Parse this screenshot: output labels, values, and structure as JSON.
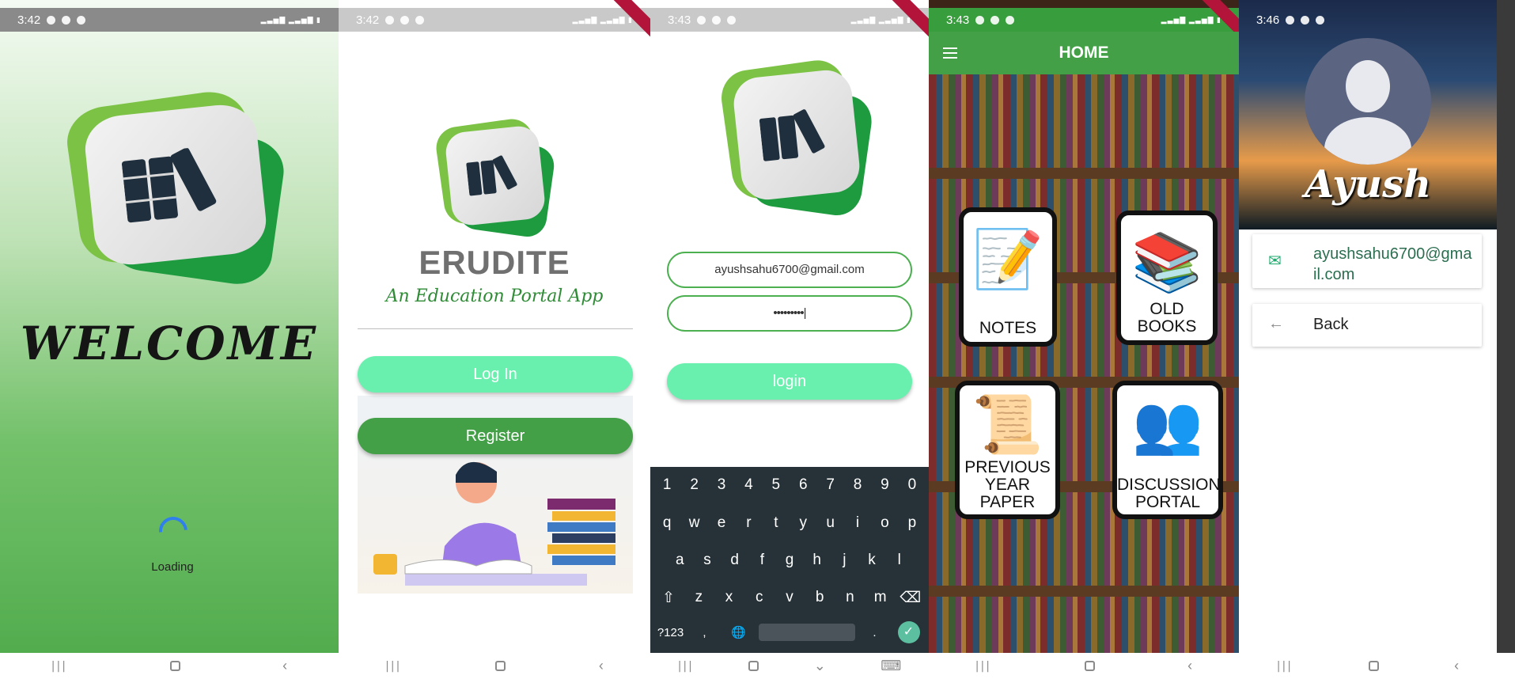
{
  "colors": {
    "green": "#43a047",
    "mint": "#69f0ae",
    "blue": "#2f80ed"
  },
  "screens": {
    "welcome": {
      "time": "3:42",
      "title": "WELCOME",
      "loading": "Loading"
    },
    "landing": {
      "time": "3:42",
      "app_name": "ERUDITE",
      "tagline": "An Education Portal App",
      "login_label": "Log In",
      "register_label": "Register"
    },
    "login": {
      "time": "3:43",
      "email_value": "ayushsahu6700@gmail.com",
      "password_value": "•••••••••|",
      "login_label": "login",
      "keyboard": {
        "row1": [
          "1",
          "2",
          "3",
          "4",
          "5",
          "6",
          "7",
          "8",
          "9",
          "0"
        ],
        "row2": [
          "q",
          "w",
          "e",
          "r",
          "t",
          "y",
          "u",
          "i",
          "o",
          "p"
        ],
        "row3": [
          "a",
          "s",
          "d",
          "f",
          "g",
          "h",
          "j",
          "k",
          "l"
        ],
        "row4": [
          "⇧",
          "z",
          "x",
          "c",
          "v",
          "b",
          "n",
          "m",
          "⌫"
        ],
        "sym_label": "?123",
        "comma": ",",
        "period": "."
      }
    },
    "home": {
      "time": "3:43",
      "title": "HOME",
      "tiles": [
        {
          "label": "NOTES",
          "icon": "notes-icon"
        },
        {
          "label": "OLD BOOKS",
          "icon": "books-icon"
        },
        {
          "label": "PREVIOUS YEAR PAPER",
          "icon": "paper-icon"
        },
        {
          "label": "DISCUSSION PORTAL",
          "icon": "group-icon"
        }
      ]
    },
    "profile": {
      "time": "3:46",
      "name": "Ayush",
      "email": "ayushsahu6700@gmail.com",
      "back_label": "Back"
    }
  }
}
